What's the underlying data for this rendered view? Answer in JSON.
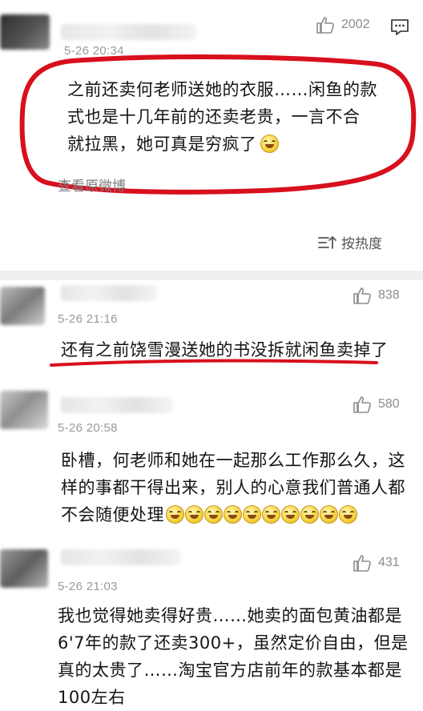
{
  "comments": [
    {
      "time": "5-26 20:34",
      "likes": "2002",
      "text_lines": [
        "之前还卖何老师送她的衣服……闲鱼的款",
        "式也是十几年前的还卖老贵，一言不合",
        "就拉黑，她可真是穷疯了"
      ],
      "emoji_count": 1
    },
    {
      "time": "5-26 21:16",
      "likes": "838",
      "text_lines": [
        "还有之前饶雪漫送她的书没拆就闲鱼卖掉了"
      ],
      "emoji_count": 0
    },
    {
      "time": "5-26 20:58",
      "likes": "580",
      "text_lines": [
        "卧槽，何老师和她在一起那么工作那么久，这",
        "样的事都干得出来，别人的心意我们普通人都",
        "不会随便处理"
      ],
      "emoji_count": 10
    },
    {
      "time": "5-26 21:03",
      "likes": "431",
      "text_lines": [
        "我也觉得她卖得好贵……她卖的面包黄油都是",
        "6'7年的款了还卖300+，虽然定价自由，但是",
        "真的太贵了……淘宝官方店前年的款基本都是",
        "100左右"
      ],
      "emoji_count": 0
    }
  ],
  "view_original": "查看原微博",
  "sort_label": "按热度",
  "colors": {
    "highlight_red": "#d8101e",
    "meta_gray": "#9a9a9a"
  },
  "icons": {
    "like": "thumbs-up-icon",
    "comment": "comment-bubble-icon",
    "sort": "sort-lines-icon"
  }
}
